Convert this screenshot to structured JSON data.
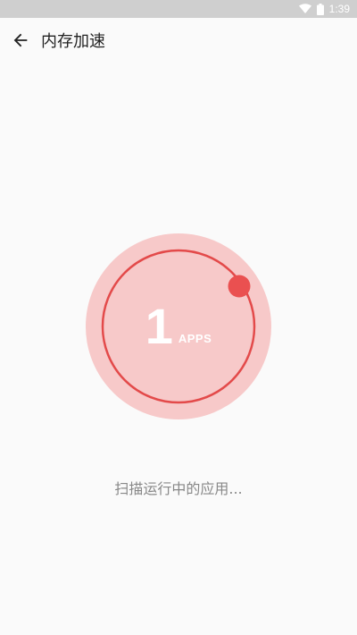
{
  "status_bar": {
    "time": "1:39",
    "icons": [
      "wifi-icon",
      "battery-icon"
    ]
  },
  "app_bar": {
    "back_icon": "arrow-left-icon",
    "title": "内存加速"
  },
  "scanner": {
    "count": "1",
    "unit": "APPS",
    "colors": {
      "outer_circle": "#f7c9c9",
      "ring": "#e34a4a",
      "dot": "#ea5050"
    }
  },
  "status_message": "扫描运行中的应用..."
}
